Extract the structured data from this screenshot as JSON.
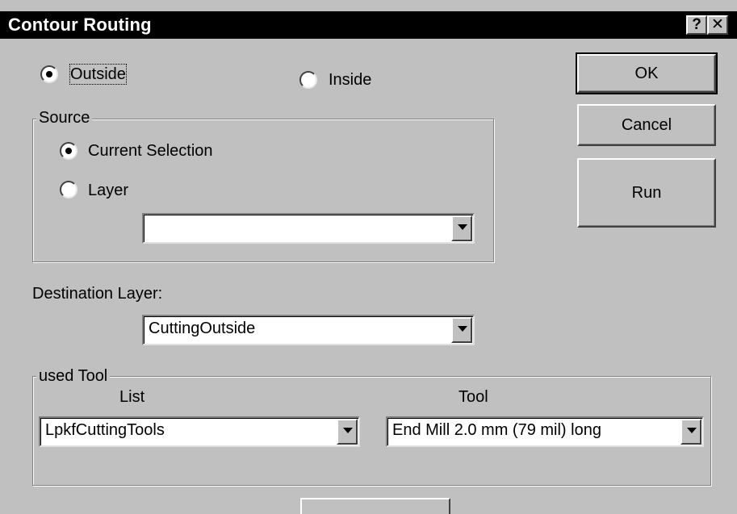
{
  "window": {
    "title": "Contour Routing",
    "help_glyph": "?",
    "close_glyph": "✕"
  },
  "mode": {
    "outside_label": "Outside",
    "inside_label": "Inside",
    "selected": "outside"
  },
  "source": {
    "group_title": "Source",
    "current_selection_label": "Current Selection",
    "layer_label": "Layer",
    "selected": "current_selection",
    "layer_combo_value": ""
  },
  "destination": {
    "label": "Destination Layer:",
    "combo_value": "CuttingOutside"
  },
  "tool_group": {
    "group_title": "used Tool",
    "list_header": "List",
    "tool_header": "Tool",
    "list_value": "LpkfCuttingTools",
    "tool_value": "End Mill 2.0 mm (79 mil) long"
  },
  "buttons": {
    "ok_label": "OK",
    "cancel_label": "Cancel",
    "run_label": "Run"
  }
}
